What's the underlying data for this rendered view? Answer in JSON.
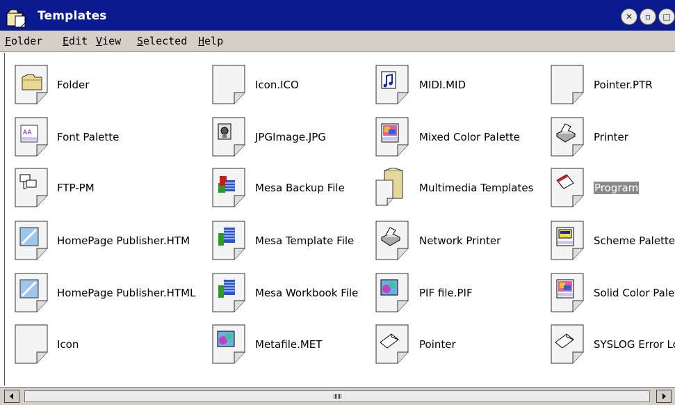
{
  "window": {
    "title": "Templates"
  },
  "menu": [
    {
      "label": "Folder",
      "underline": "F",
      "rest": "older"
    },
    {
      "label": "Edit",
      "underline": "E",
      "rest": "dit"
    },
    {
      "label": "View",
      "underline": "V",
      "rest": "iew"
    },
    {
      "label": "Selected",
      "underline": "S",
      "rest": "elected"
    },
    {
      "label": "Help",
      "underline": "H",
      "rest": "elp"
    }
  ],
  "items": {
    "c1": [
      {
        "label": "Folder",
        "icon": "folder-icon"
      },
      {
        "label": "Font Palette",
        "icon": "font-palette-icon"
      },
      {
        "label": "FTP-PM",
        "icon": "ftp-icon"
      },
      {
        "label": "HomePage Publisher.HTM",
        "icon": "web-page-icon"
      },
      {
        "label": "HomePage Publisher.HTML",
        "icon": "web-page-icon"
      },
      {
        "label": "Icon",
        "icon": "blank-document-icon"
      }
    ],
    "c2": [
      {
        "label": "Icon.ICO",
        "icon": "blank-document-icon"
      },
      {
        "label": "JPGImage.JPG",
        "icon": "image-icon"
      },
      {
        "label": "Mesa Backup File",
        "icon": "mesa-backup-icon"
      },
      {
        "label": "Mesa Template File",
        "icon": "mesa-spreadsheet-icon"
      },
      {
        "label": "Mesa Workbook File",
        "icon": "mesa-spreadsheet-icon"
      },
      {
        "label": "Metafile.MET",
        "icon": "metafile-icon"
      }
    ],
    "c3": [
      {
        "label": "MIDI.MID",
        "icon": "music-note-icon"
      },
      {
        "label": "Mixed Color Palette",
        "icon": "color-palette-icon"
      },
      {
        "label": "Multimedia Templates",
        "icon": "folder-icon"
      },
      {
        "label": "Network Printer",
        "icon": "printer-icon"
      },
      {
        "label": "PIF file.PIF",
        "icon": "pif-icon"
      },
      {
        "label": "Pointer",
        "icon": "pointer-icon"
      }
    ],
    "c4": [
      {
        "label": "Pointer.PTR",
        "icon": "blank-document-icon"
      },
      {
        "label": "Printer",
        "icon": "printer-icon"
      },
      {
        "label": "Program",
        "icon": "program-icon",
        "selected": true
      },
      {
        "label": "Scheme Palette",
        "icon": "scheme-palette-icon"
      },
      {
        "label": "Solid Color Palet",
        "icon": "color-palette-icon"
      },
      {
        "label": "SYSLOG Error Lo",
        "icon": "pointer-icon"
      }
    ]
  },
  "colors": {
    "titlebar": "#0b1a8f",
    "menubar": "#d4d0c8",
    "selection": "#8a8a8a"
  }
}
